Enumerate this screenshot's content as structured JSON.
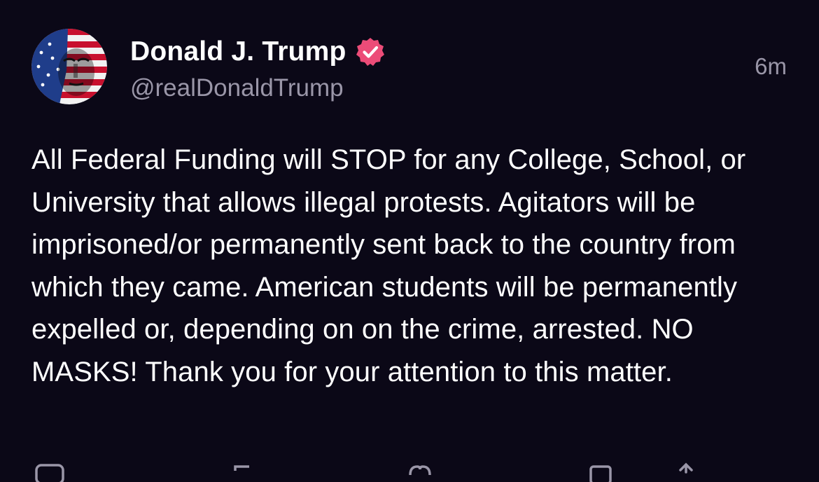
{
  "post": {
    "author": {
      "display_name": "Donald J. Trump",
      "handle": "@realDonaldTrump",
      "verified": true,
      "avatar_icon": "avatar-flag-portrait"
    },
    "timestamp": "6m",
    "body": "All Federal Funding will STOP for any College, School, or University that allows illegal protests. Agitators will be imprisoned/or permanently sent back to the country from which they came. American students will be permanently expelled or, depending on on the crime, arrested. NO MASKS! Thank you for your attention to this matter.",
    "actions": [
      {
        "icon": "reply-icon"
      },
      {
        "icon": "retruth-icon"
      },
      {
        "icon": "like-icon"
      },
      {
        "icon": "bookmark-icon"
      },
      {
        "icon": "share-icon"
      }
    ]
  },
  "colors": {
    "background": "#0b0817",
    "text_primary": "#ffffff",
    "text_secondary": "#9a96a8",
    "verified_badge": "#ec4c78"
  }
}
